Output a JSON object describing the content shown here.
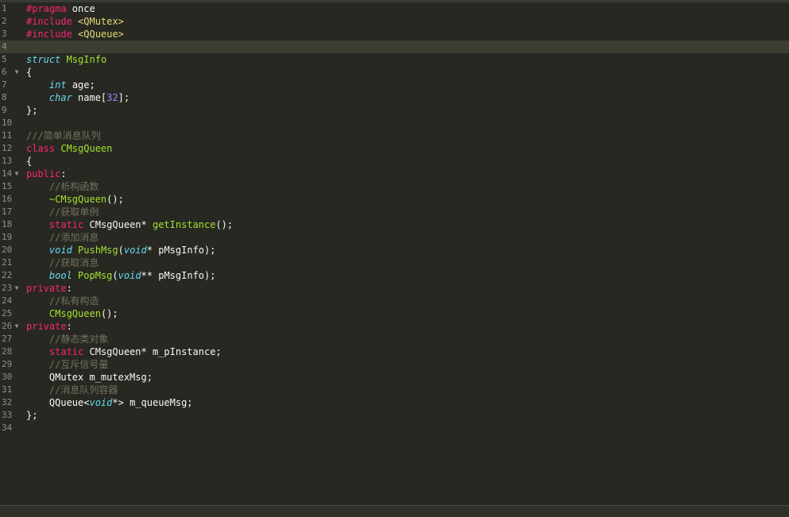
{
  "editor": {
    "active_line": 4,
    "colors": {
      "background": "#272822",
      "keyword": "#f92672",
      "type": "#66d9ef",
      "name": "#a6e22e",
      "number": "#ae81ff",
      "comment": "#75715e",
      "text": "#f8f8f2"
    },
    "fold_icon": "fold-triangle-icon",
    "lines": [
      {
        "n": "1",
        "fold": false,
        "tokens": [
          {
            "t": "#pragma",
            "c": "pre"
          },
          {
            "t": " once",
            "c": "plain"
          }
        ]
      },
      {
        "n": "2",
        "fold": false,
        "tokens": [
          {
            "t": "#include ",
            "c": "pre"
          },
          {
            "t": "<QMutex>",
            "c": "str"
          }
        ]
      },
      {
        "n": "3",
        "fold": false,
        "tokens": [
          {
            "t": "#include ",
            "c": "pre"
          },
          {
            "t": "<QQueue>",
            "c": "str"
          }
        ]
      },
      {
        "n": "4",
        "fold": false,
        "tokens": []
      },
      {
        "n": "5",
        "fold": false,
        "tokens": [
          {
            "t": "struct",
            "c": "type"
          },
          {
            "t": " ",
            "c": "plain"
          },
          {
            "t": "MsgInfo",
            "c": "name"
          }
        ]
      },
      {
        "n": "6",
        "fold": true,
        "tokens": [
          {
            "t": "{",
            "c": "plain"
          }
        ]
      },
      {
        "n": "7",
        "fold": false,
        "tokens": [
          {
            "t": "    ",
            "c": "plain"
          },
          {
            "t": "int",
            "c": "type"
          },
          {
            "t": " age;",
            "c": "plain"
          }
        ]
      },
      {
        "n": "8",
        "fold": false,
        "tokens": [
          {
            "t": "    ",
            "c": "plain"
          },
          {
            "t": "char",
            "c": "type"
          },
          {
            "t": " name[",
            "c": "plain"
          },
          {
            "t": "32",
            "c": "num"
          },
          {
            "t": "];",
            "c": "plain"
          }
        ]
      },
      {
        "n": "9",
        "fold": false,
        "tokens": [
          {
            "t": "};",
            "c": "plain"
          }
        ]
      },
      {
        "n": "10",
        "fold": false,
        "tokens": []
      },
      {
        "n": "11",
        "fold": false,
        "tokens": [
          {
            "t": "///简单消息队列",
            "c": "cmt"
          }
        ]
      },
      {
        "n": "12",
        "fold": false,
        "tokens": [
          {
            "t": "class",
            "c": "kw"
          },
          {
            "t": " ",
            "c": "plain"
          },
          {
            "t": "CMsgQueen",
            "c": "name"
          }
        ]
      },
      {
        "n": "13",
        "fold": false,
        "tokens": [
          {
            "t": "{",
            "c": "plain"
          }
        ]
      },
      {
        "n": "14",
        "fold": true,
        "tokens": [
          {
            "t": "public",
            "c": "kw"
          },
          {
            "t": ":",
            "c": "plain"
          }
        ]
      },
      {
        "n": "15",
        "fold": false,
        "tokens": [
          {
            "t": "    ",
            "c": "plain"
          },
          {
            "t": "//析构函数",
            "c": "cmt"
          }
        ]
      },
      {
        "n": "16",
        "fold": false,
        "tokens": [
          {
            "t": "    ",
            "c": "plain"
          },
          {
            "t": "~CMsgQueen",
            "c": "name"
          },
          {
            "t": "();",
            "c": "plain"
          }
        ]
      },
      {
        "n": "17",
        "fold": false,
        "tokens": [
          {
            "t": "    ",
            "c": "plain"
          },
          {
            "t": "//获取单例",
            "c": "cmt"
          }
        ]
      },
      {
        "n": "18",
        "fold": false,
        "tokens": [
          {
            "t": "    ",
            "c": "plain"
          },
          {
            "t": "static",
            "c": "kw"
          },
          {
            "t": " CMsgQueen* ",
            "c": "plain"
          },
          {
            "t": "getInstance",
            "c": "name"
          },
          {
            "t": "();",
            "c": "plain"
          }
        ]
      },
      {
        "n": "19",
        "fold": false,
        "tokens": [
          {
            "t": "    ",
            "c": "plain"
          },
          {
            "t": "//添加消息",
            "c": "cmt"
          }
        ]
      },
      {
        "n": "20",
        "fold": false,
        "tokens": [
          {
            "t": "    ",
            "c": "plain"
          },
          {
            "t": "void",
            "c": "type"
          },
          {
            "t": " ",
            "c": "plain"
          },
          {
            "t": "PushMsg",
            "c": "name"
          },
          {
            "t": "(",
            "c": "plain"
          },
          {
            "t": "void",
            "c": "type"
          },
          {
            "t": "* pMsgInfo);",
            "c": "plain"
          }
        ]
      },
      {
        "n": "21",
        "fold": false,
        "tokens": [
          {
            "t": "    ",
            "c": "plain"
          },
          {
            "t": "//获取消息",
            "c": "cmt"
          }
        ]
      },
      {
        "n": "22",
        "fold": false,
        "tokens": [
          {
            "t": "    ",
            "c": "plain"
          },
          {
            "t": "bool",
            "c": "type"
          },
          {
            "t": " ",
            "c": "plain"
          },
          {
            "t": "PopMsg",
            "c": "name"
          },
          {
            "t": "(",
            "c": "plain"
          },
          {
            "t": "void",
            "c": "type"
          },
          {
            "t": "** pMsgInfo);",
            "c": "plain"
          }
        ]
      },
      {
        "n": "23",
        "fold": true,
        "tokens": [
          {
            "t": "private",
            "c": "kw"
          },
          {
            "t": ":",
            "c": "plain"
          }
        ]
      },
      {
        "n": "24",
        "fold": false,
        "tokens": [
          {
            "t": "    ",
            "c": "plain"
          },
          {
            "t": "//私有构造",
            "c": "cmt"
          }
        ]
      },
      {
        "n": "25",
        "fold": false,
        "tokens": [
          {
            "t": "    ",
            "c": "plain"
          },
          {
            "t": "CMsgQueen",
            "c": "name"
          },
          {
            "t": "();",
            "c": "plain"
          }
        ]
      },
      {
        "n": "26",
        "fold": true,
        "tokens": [
          {
            "t": "private",
            "c": "kw"
          },
          {
            "t": ":",
            "c": "plain"
          }
        ]
      },
      {
        "n": "27",
        "fold": false,
        "tokens": [
          {
            "t": "    ",
            "c": "plain"
          },
          {
            "t": "//静态类对象",
            "c": "cmt"
          }
        ]
      },
      {
        "n": "28",
        "fold": false,
        "tokens": [
          {
            "t": "    ",
            "c": "plain"
          },
          {
            "t": "static",
            "c": "kw"
          },
          {
            "t": " CMsgQueen* m_pInstance;",
            "c": "plain"
          }
        ]
      },
      {
        "n": "29",
        "fold": false,
        "tokens": [
          {
            "t": "    ",
            "c": "plain"
          },
          {
            "t": "//互斥信号量",
            "c": "cmt"
          }
        ]
      },
      {
        "n": "30",
        "fold": false,
        "tokens": [
          {
            "t": "    QMutex m_mutexMsg;",
            "c": "plain"
          }
        ]
      },
      {
        "n": "31",
        "fold": false,
        "tokens": [
          {
            "t": "    ",
            "c": "plain"
          },
          {
            "t": "//消息队列容器",
            "c": "cmt"
          }
        ]
      },
      {
        "n": "32",
        "fold": false,
        "tokens": [
          {
            "t": "    QQueue<",
            "c": "plain"
          },
          {
            "t": "void",
            "c": "type"
          },
          {
            "t": "*> m_queueMsg;",
            "c": "plain"
          }
        ]
      },
      {
        "n": "33",
        "fold": false,
        "tokens": [
          {
            "t": "};",
            "c": "plain"
          }
        ]
      },
      {
        "n": "34",
        "fold": false,
        "tokens": []
      }
    ]
  }
}
